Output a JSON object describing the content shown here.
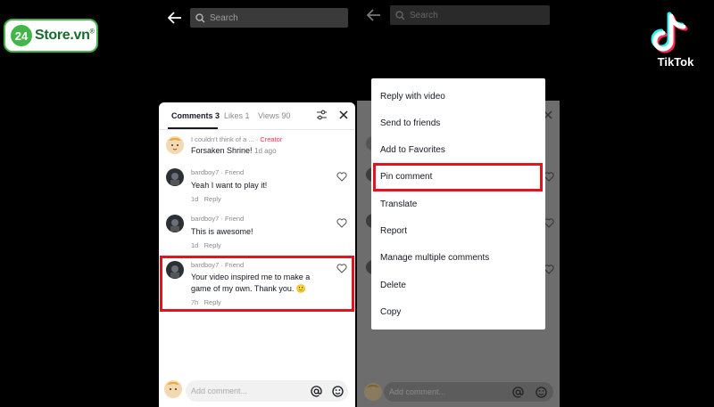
{
  "branding": {
    "store_number": "24",
    "store_name": "Store.vn",
    "store_mark": "®",
    "tiktok_name": "TikTok"
  },
  "search": {
    "placeholder": "Search"
  },
  "comments_panel": {
    "tabs": [
      {
        "label": "Comments 3",
        "active": true
      },
      {
        "label": "Likes 1",
        "active": false
      },
      {
        "label": "Views 90",
        "active": false
      }
    ],
    "creator_comment": {
      "name": "I couldn't think of a ...",
      "badge": "· Creator",
      "text": "Forsaken Shrine!",
      "time": "1d ago"
    },
    "comments": [
      {
        "user": "bardboy7",
        "relation": "· Friend",
        "lines": [
          "Yeah I want to play it!"
        ],
        "time": "1d",
        "reply": "Reply"
      },
      {
        "user": "bardboy7",
        "relation": "· Friend",
        "lines": [
          "This is awesome!"
        ],
        "time": "1d",
        "reply": "Reply"
      },
      {
        "user": "bardboy7",
        "relation": "· Friend",
        "lines": [
          "Your video inspired me to make a",
          "game of my own. Thank you. 🙂"
        ],
        "time": "7h",
        "reply": "Reply"
      }
    ],
    "add_comment_placeholder": "Add comment..."
  },
  "context_menu": {
    "items": [
      "Reply with video",
      "Send to friends",
      "Add to Favorites",
      "Pin comment",
      "Translate",
      "Report",
      "Manage multiple comments",
      "Delete",
      "Copy"
    ],
    "highlighted": "Pin comment"
  },
  "highlight_color": "#e4141e",
  "accent_color": "#fe2c55",
  "icons": [
    "back-arrow-icon",
    "search-icon",
    "filter-icon",
    "close-icon",
    "heart-icon",
    "at-icon",
    "emoji-icon",
    "avatar-icon"
  ]
}
